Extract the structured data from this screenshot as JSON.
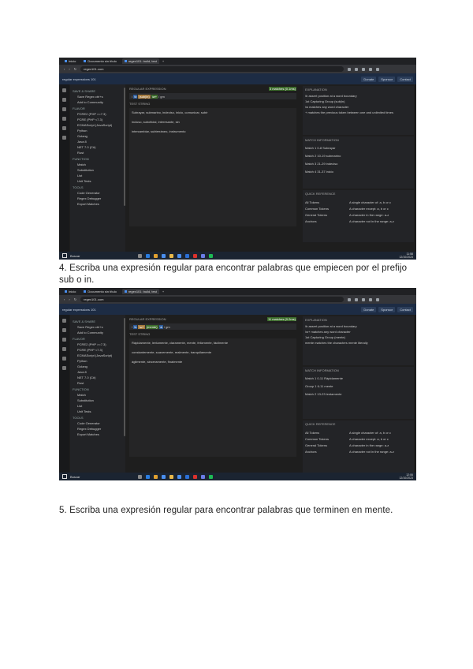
{
  "screenshots": [
    {
      "tabs": [
        "Inicio",
        "Documento sin título",
        "regex101: build, test"
      ],
      "url": "regex101.com",
      "header_title": "regular expressions 101",
      "header_buttons": [
        "Donate",
        "Sponsor",
        "Contact"
      ],
      "left_sections": [
        {
          "title": "SAVE & SHARE",
          "items": [
            "Save Regex ctrl+s",
            "Add to Community"
          ]
        },
        {
          "title": "FLAVOR",
          "items": [
            "PCRE2 (PHP >=7.3)",
            "PCRE (PHP <7.3)",
            "ECMAScript (JavaScript)",
            "Python",
            "Golang",
            "Java 8",
            "NET 7.0 (C#)",
            "Rust"
          ]
        },
        {
          "title": "FUNCTION",
          "items": [
            "Match",
            "Substitution",
            "List",
            "Unit Tests"
          ]
        },
        {
          "title": "TOOLS",
          "items": [
            "Code Generator",
            "Regex Debugger",
            "Export Matches"
          ]
        }
      ],
      "regex_label": "REGULAR EXPRESSION",
      "regex_meta": "3 matches (0.1ms)",
      "regex_parts": [
        "\\b",
        "(sub|in)",
        "\\w+"
      ],
      "test_label": "TEST STRING",
      "test_lines": [
        "Subrayar, submarino, indeciso, inicio, comunicar, subir",
        "incluso, suboficial, interesante, sin",
        "intercambiar, subterráneo, instrumento"
      ],
      "explanation_label": "EXPLANATION",
      "explanation_lines": [
        "\\b assert position at a word boundary",
        "1st Capturing Group (sub|in)",
        "\\w matches any word character",
        "+ matches the previous token between one and unlimited times"
      ],
      "match_label": "MATCH INFORMATION",
      "matches": [
        "Match 1  0-8  Subrayar",
        "Match 2  10-19  submarino",
        "Match 3  21-29  indeciso",
        "Match 4  31-37  inicio"
      ],
      "quickref_label": "QUICK REFERENCE",
      "quickref_items": [
        "All Tokens",
        "Common Tokens",
        "General Tokens",
        "Anchors"
      ],
      "quickref_right": [
        "A single character of: a, b or c",
        "A character except: a, b or c",
        "A character in the range: a-z",
        "A character not in the range: a-z"
      ],
      "taskbar_search": "Buscar",
      "clock": [
        "11:58",
        "12/10/2023"
      ]
    },
    {
      "tabs": [
        "Inicio",
        "Documento sin título",
        "regex101: build, test"
      ],
      "url": "regex101.com",
      "header_title": "regular expressions 101",
      "header_buttons": [
        "Donate",
        "Sponsor",
        "Contact"
      ],
      "left_sections": [
        {
          "title": "SAVE & SHARE",
          "items": [
            "Save Regex ctrl+s",
            "Add to Community"
          ]
        },
        {
          "title": "FLAVOR",
          "items": [
            "PCRE2 (PHP >=7.3)",
            "PCRE (PHP <7.3)",
            "ECMAScript (JavaScript)",
            "Python",
            "Golang",
            "Java 8",
            "NET 7.0 (C#)",
            "Rust"
          ]
        },
        {
          "title": "FUNCTION",
          "items": [
            "Match",
            "Substitution",
            "List",
            "Unit Tests"
          ]
        },
        {
          "title": "TOOLS",
          "items": [
            "Code Generator",
            "Regex Debugger",
            "Export Matches"
          ]
        }
      ],
      "regex_label": "REGULAR EXPRESSION",
      "regex_meta": "11 matches (0.2ms)",
      "regex_parts": [
        "\\b",
        "\\w+",
        "(mente)",
        "\\b"
      ],
      "test_label": "TEST STRING",
      "test_lines": [
        "Rápidamente, lentamente, claramente, mente, felizmente, fácilmente",
        "constantemente, suavemente, realmente, tranquilamente",
        "",
        "",
        "ágilmente, sinceramente, finalmente"
      ],
      "explanation_label": "EXPLANATION",
      "explanation_lines": [
        "\\b assert position at a word boundary",
        "\\w+ matches any word character",
        "1st Capturing Group (mente)",
        "mente matches the characters mente literally"
      ],
      "match_label": "MATCH INFORMATION",
      "matches": [
        "Match 1  0-11  Rápidamente",
        "Group 1  6-11  mente",
        "Match 2  13-23  lentamente"
      ],
      "quickref_label": "QUICK REFERENCE",
      "quickref_items": [
        "All Tokens",
        "Common Tokens",
        "General Tokens",
        "Anchors"
      ],
      "quickref_right": [
        "A single character of: a, b or c",
        "A character except: a, b or c",
        "A character in the range: a-z",
        "A character not in the range: a-z"
      ],
      "taskbar_search": "Buscar",
      "clock": [
        "12:06",
        "12/10/2023"
      ]
    }
  ],
  "captions": [
    "4. Escriba una expresión regular para encontrar palabras que empiecen por el prefijo sub o in.",
    "5. Escriba una expresión regular para encontrar palabras que terminen en mente."
  ]
}
